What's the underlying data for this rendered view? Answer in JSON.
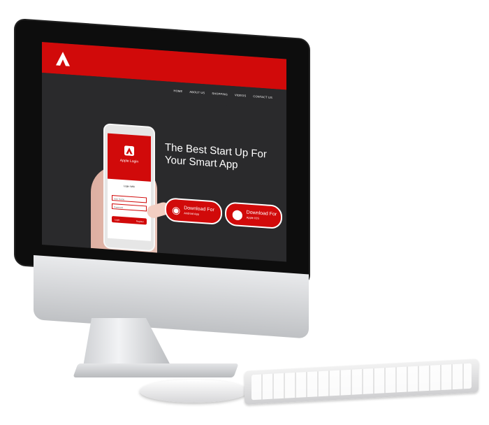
{
  "topbar": {
    "accent_color": "#d10a0a",
    "logo_icon": "a-logo-icon"
  },
  "nav": {
    "items": [
      "HOME",
      "ABOUT US",
      "SHOPPING",
      "VIDEOS",
      "CONTACT US"
    ]
  },
  "hero": {
    "headline": "The Best Start Up For Your Smart App",
    "android_button": {
      "title": "Download For",
      "subtitle": "Android App",
      "icon": "android-icon"
    },
    "ios_button": {
      "title": "Download For",
      "subtitle": "Apple IOS",
      "icon": "apple-icon"
    }
  },
  "phone": {
    "app_title": "Apple Login",
    "login_with": "Login With",
    "username_placeholder": "User Name",
    "password_placeholder": "Password",
    "login_button": "Login",
    "register_button": "Register"
  }
}
